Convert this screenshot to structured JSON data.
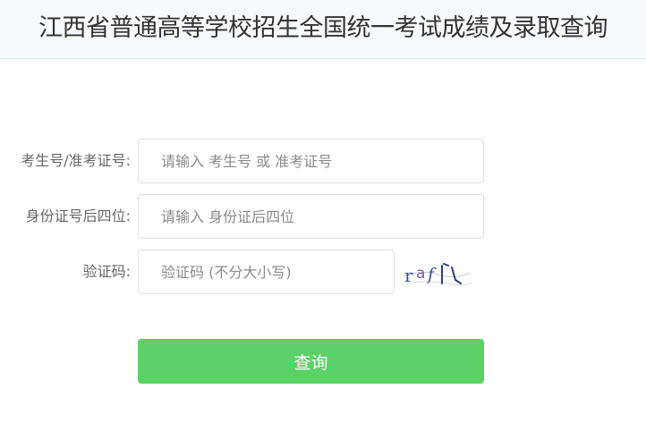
{
  "header": {
    "title": "江西省普通高等学校招生全国统一考试成绩及录取查询"
  },
  "form": {
    "exam_id": {
      "label": "考生号/准考证号:",
      "placeholder": "请输入 考生号 或 准考证号",
      "value": ""
    },
    "id_last4": {
      "label": "身份证号后四位:",
      "placeholder": "请输入 身份证后四位",
      "value": ""
    },
    "captcha": {
      "label": "验证码:",
      "placeholder": "验证码 (不分大小写)",
      "value": "",
      "image_text": "raf J"
    },
    "submit_label": "查询"
  },
  "colors": {
    "header_bg": "#f6f9fd",
    "button_bg": "#5bd168",
    "button_text": "#ffffff",
    "label_text": "#666666",
    "input_border": "#dcdfe6"
  }
}
